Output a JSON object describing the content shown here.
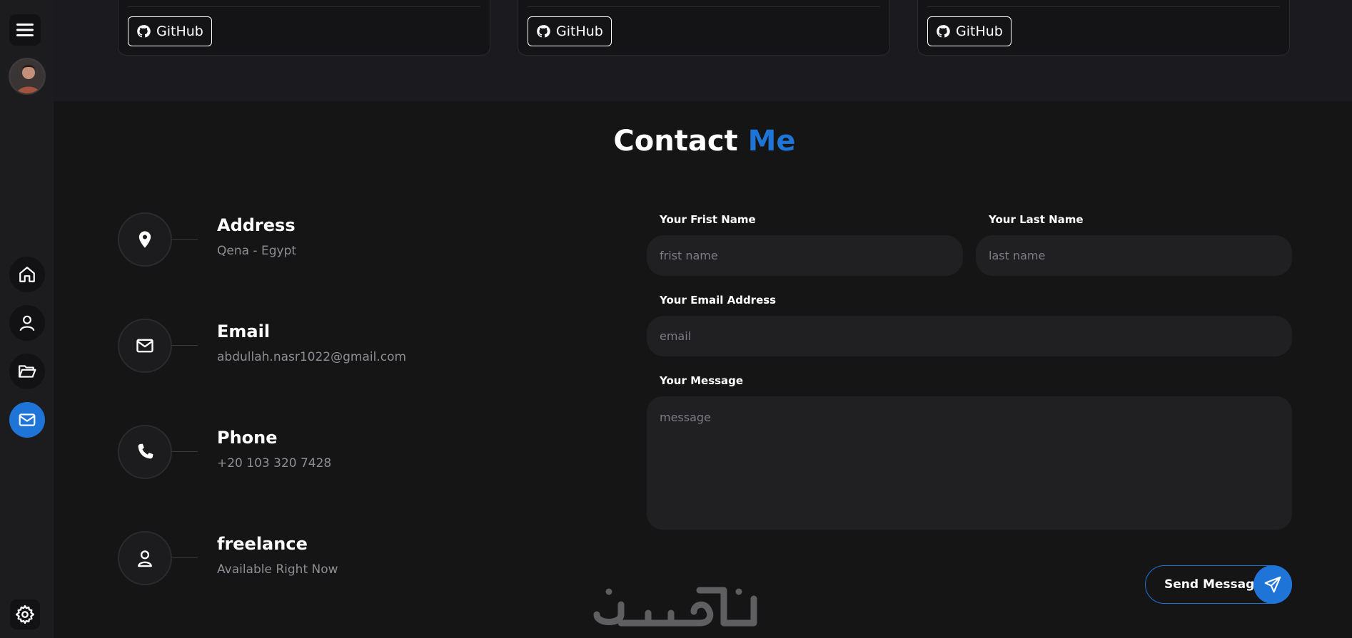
{
  "sidebar": {
    "items": [
      {
        "icon": "home-icon"
      },
      {
        "icon": "user-icon"
      },
      {
        "icon": "folder-icon"
      },
      {
        "icon": "mail-icon",
        "active": true
      }
    ]
  },
  "projects": {
    "cards": [
      {
        "github_label": "GitHub"
      },
      {
        "github_label": "GitHub"
      },
      {
        "github_label": "GitHub"
      }
    ]
  },
  "contact": {
    "title": "Contact",
    "title_accent": "Me",
    "info": [
      {
        "icon": "location-pin-icon",
        "title": "Address",
        "value": "Qena - Egypt"
      },
      {
        "icon": "envelope-icon",
        "title": "Email",
        "value": "abdullah.nasr1022@gmail.com"
      },
      {
        "icon": "phone-icon",
        "title": "Phone",
        "value": "+20 103 320 7428"
      },
      {
        "icon": "user-icon",
        "title": "freelance",
        "value": "Available Right Now"
      }
    ],
    "form": {
      "first_name_label": "Your Frist Name",
      "first_name_placeholder": "frist name",
      "last_name_label": "Your Last Name",
      "last_name_placeholder": "last name",
      "email_label": "Your Email Address",
      "email_placeholder": "email",
      "message_label": "Your Message",
      "message_placeholder": "message",
      "send_label": "Send Message"
    }
  },
  "watermark": {
    "text": "خمسات"
  },
  "colors": {
    "accent": "#1f74d8",
    "background": "#151516",
    "panel": "#1c1c1f"
  }
}
